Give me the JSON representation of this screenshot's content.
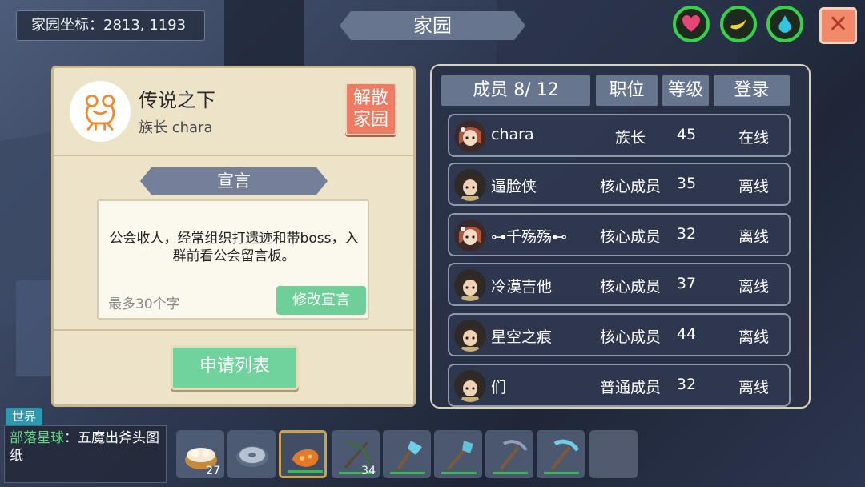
{
  "hud": {
    "coordinates": "家园坐标：2813, 1193",
    "title": "家园",
    "close_label": "✕",
    "icons": [
      "heart-icon",
      "banana-icon",
      "water-drop-icon"
    ]
  },
  "home": {
    "name": "传说之下",
    "leader": "族长  chara",
    "dissolve_label": "解散家园",
    "declaration_title": "宣言",
    "declaration_text": "公会收人，经常组织打遗迹和带boss，入群前看公会留言板。",
    "declaration_limit": "最多30个字",
    "edit_label": "修改宣言",
    "apply_list_label": "申请列表"
  },
  "members": {
    "headers": {
      "count": "成员 8/ 12",
      "role": "职位",
      "level": "等级",
      "login": "登录"
    },
    "rows": [
      {
        "name": "chara",
        "role": "族长",
        "level": "45",
        "status": "在线",
        "avatar": "girl"
      },
      {
        "name": "逼脸侠",
        "role": "核心成员",
        "level": "35",
        "status": "离线",
        "avatar": "boy"
      },
      {
        "name": "⊶千殇殇⊷",
        "role": "核心成员",
        "level": "32",
        "status": "离线",
        "avatar": "girl"
      },
      {
        "name": "冷漠吉他",
        "role": "核心成员",
        "level": "37",
        "status": "离线",
        "avatar": "boy"
      },
      {
        "name": "星空之痕",
        "role": "核心成员",
        "level": "44",
        "status": "离线",
        "avatar": "boy"
      },
      {
        "name": "们",
        "role": "普通成员",
        "level": "32",
        "status": "离线",
        "avatar": "boy"
      }
    ]
  },
  "chat": {
    "channel": "世界",
    "source": "部落星球",
    "message": "：五魔出斧头图纸"
  },
  "hotbar": {
    "slots": [
      {
        "item": "dumpling-basket-icon",
        "count": "27"
      },
      {
        "item": "stone-disc-icon",
        "count": ""
      },
      {
        "item": "orange-gourd-icon",
        "count": "",
        "selected": true
      },
      {
        "item": "bow-icon",
        "count": "34"
      },
      {
        "item": "crystal-axe-icon",
        "count": ""
      },
      {
        "item": "crystal-shovel-icon",
        "count": ""
      },
      {
        "item": "pickaxe-icon",
        "count": ""
      },
      {
        "item": "crystal-pickaxe-icon",
        "count": ""
      },
      {
        "item": "empty-slot",
        "count": ""
      }
    ]
  }
}
